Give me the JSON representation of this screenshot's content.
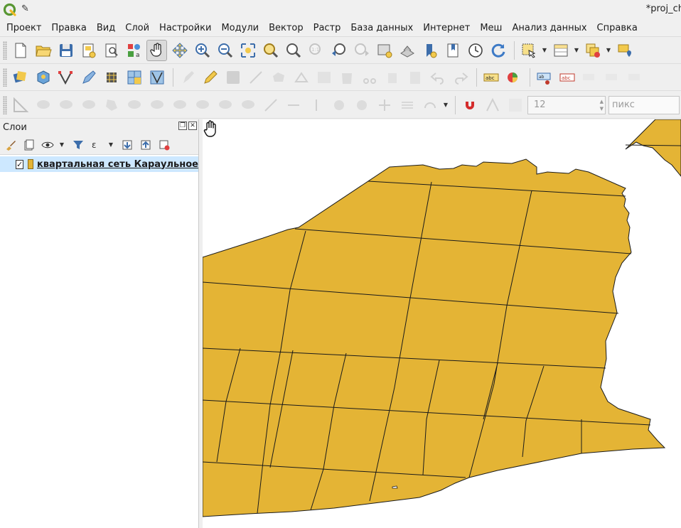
{
  "window": {
    "title": "*proj_ch"
  },
  "menu": [
    "Проект",
    "Правка",
    "Вид",
    "Слой",
    "Настройки",
    "Модули",
    "Вектор",
    "Растр",
    "База данных",
    "Интернет",
    "Меш",
    "Анализ данных",
    "Справка"
  ],
  "snapping": {
    "tolerance_value": "12",
    "units_placeholder": "пикс"
  },
  "layers_panel": {
    "title": "Слои",
    "layers": [
      {
        "name": "квартальная сеть Караульное",
        "visible": true,
        "fill_color": "#e4b435"
      }
    ]
  },
  "map": {
    "polygon_fill": "#e4b435",
    "outline": "#1a1a1a"
  },
  "icons": [
    "qgis-logo-icon",
    "pin-icon",
    "new-project-icon",
    "open-project-icon",
    "save-project-icon",
    "pan-hand-icon",
    "zoom-in-icon",
    "zoom-out-icon",
    "refresh-icon",
    "magnet-snapping-icon"
  ]
}
